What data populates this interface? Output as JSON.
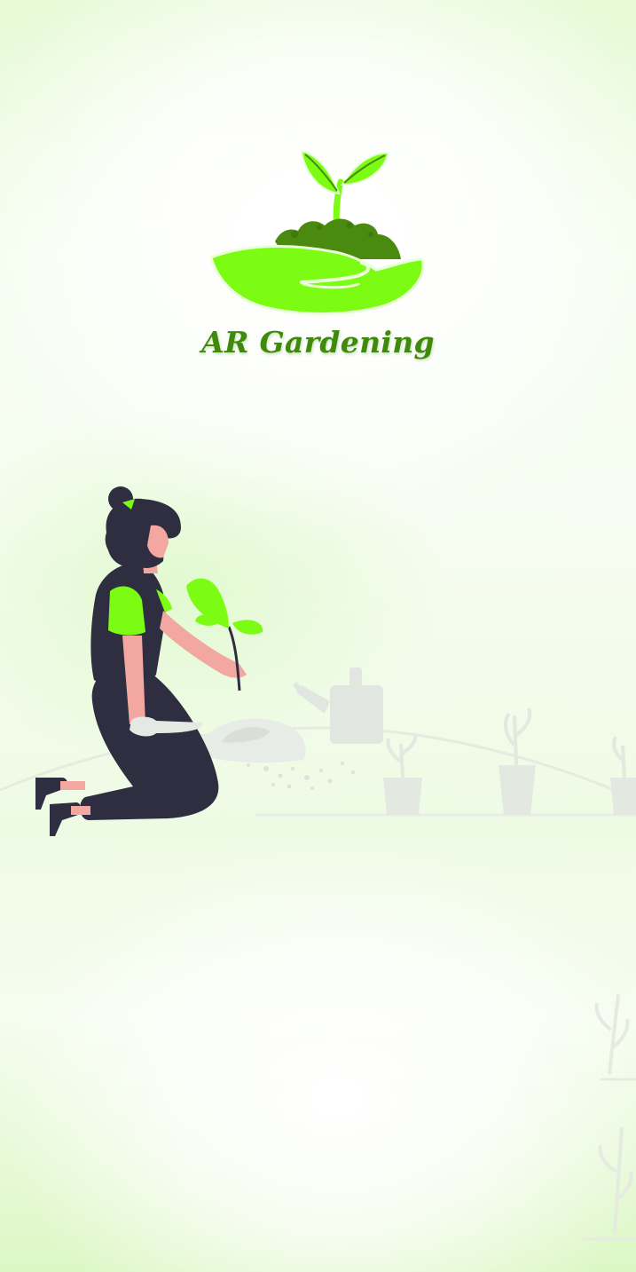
{
  "app": {
    "title": "AR Gardening"
  },
  "logo": {
    "icon": "seedling-in-hand-icon"
  },
  "illustration": {
    "subject": "woman-gardening-illustration"
  },
  "colors": {
    "brand_green": "#7cfc12",
    "dark_green": "#3f8a0c",
    "soil_green": "#4a8a0e",
    "figure_dark": "#2f2e41",
    "skin": "#f2a7a0"
  }
}
